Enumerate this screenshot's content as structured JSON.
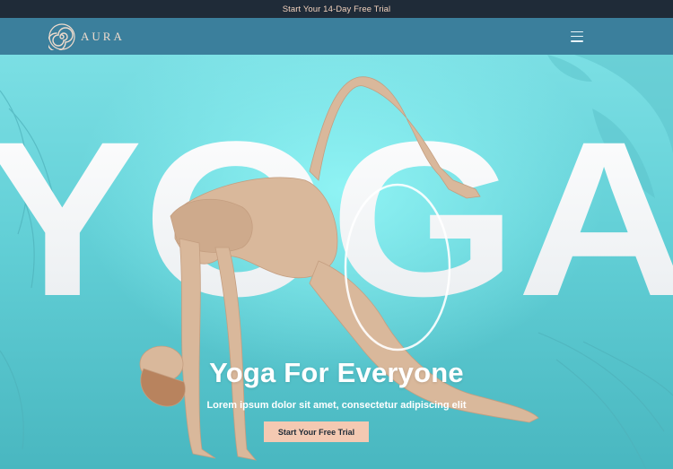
{
  "topbar": {
    "promo_text": "Start Your 14-Day Free Trial"
  },
  "navbar": {
    "logo_text": "AURA",
    "logo_icon": "spiral-logo-icon",
    "menu_icon": "hamburger-menu-icon"
  },
  "hero": {
    "big_word": "YOGA",
    "title": "Yoga For Everyone",
    "subtitle": "Lorem ipsum dolor sit amet, consectetur adipiscing elit",
    "cta_label": "Start Your Free Trial"
  },
  "colors": {
    "topbar_bg": "#1f2b38",
    "navbar_bg": "#3b7f9c",
    "hero_bg": "#7bdfe4",
    "cta_bg": "#f4c9b2",
    "accent_text": "#f2d2bd"
  }
}
